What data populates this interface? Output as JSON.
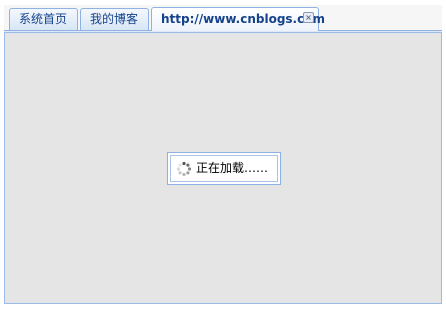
{
  "tabs": [
    {
      "label": "系统首页",
      "active": false
    },
    {
      "label": "我的博客",
      "active": false
    },
    {
      "label": "http://www.cnblogs.com",
      "active": true,
      "closable": true
    }
  ],
  "close_glyph": "×",
  "loading": {
    "text": "正在加载……",
    "icon": "spinner-icon"
  },
  "colors": {
    "tab_border": "#8db2e3",
    "tab_text": "#15428b",
    "body_background": "#e5e5e5"
  }
}
